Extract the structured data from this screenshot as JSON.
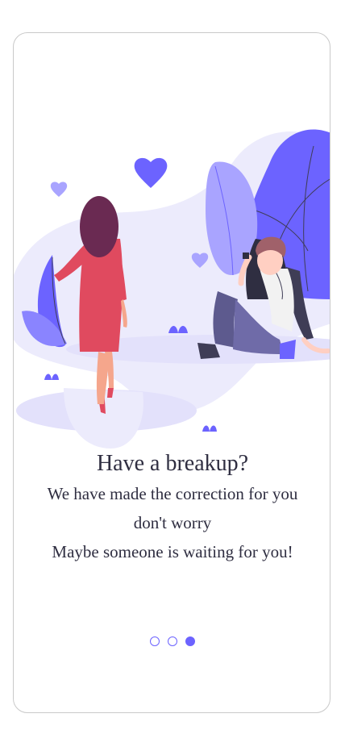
{
  "onboarding": {
    "title": "Have a breakup?",
    "lines": [
      "We have made the correction for you",
      "don't worry",
      "Maybe someone is waiting for you!"
    ],
    "page_indicator": {
      "total": 3,
      "active_index": 2
    }
  },
  "colors": {
    "accent": "#6c63ff",
    "text": "#2f2e41",
    "card_border": "#c9c9c9",
    "background_blob": "#e8e6fb",
    "dress": "#e04a5f",
    "hair": "#6a2a52"
  },
  "illustration": {
    "name": "breakup-illustration",
    "icons": [
      "heart-icon",
      "heart-icon",
      "heart-icon",
      "plant-leaf-icon"
    ]
  }
}
